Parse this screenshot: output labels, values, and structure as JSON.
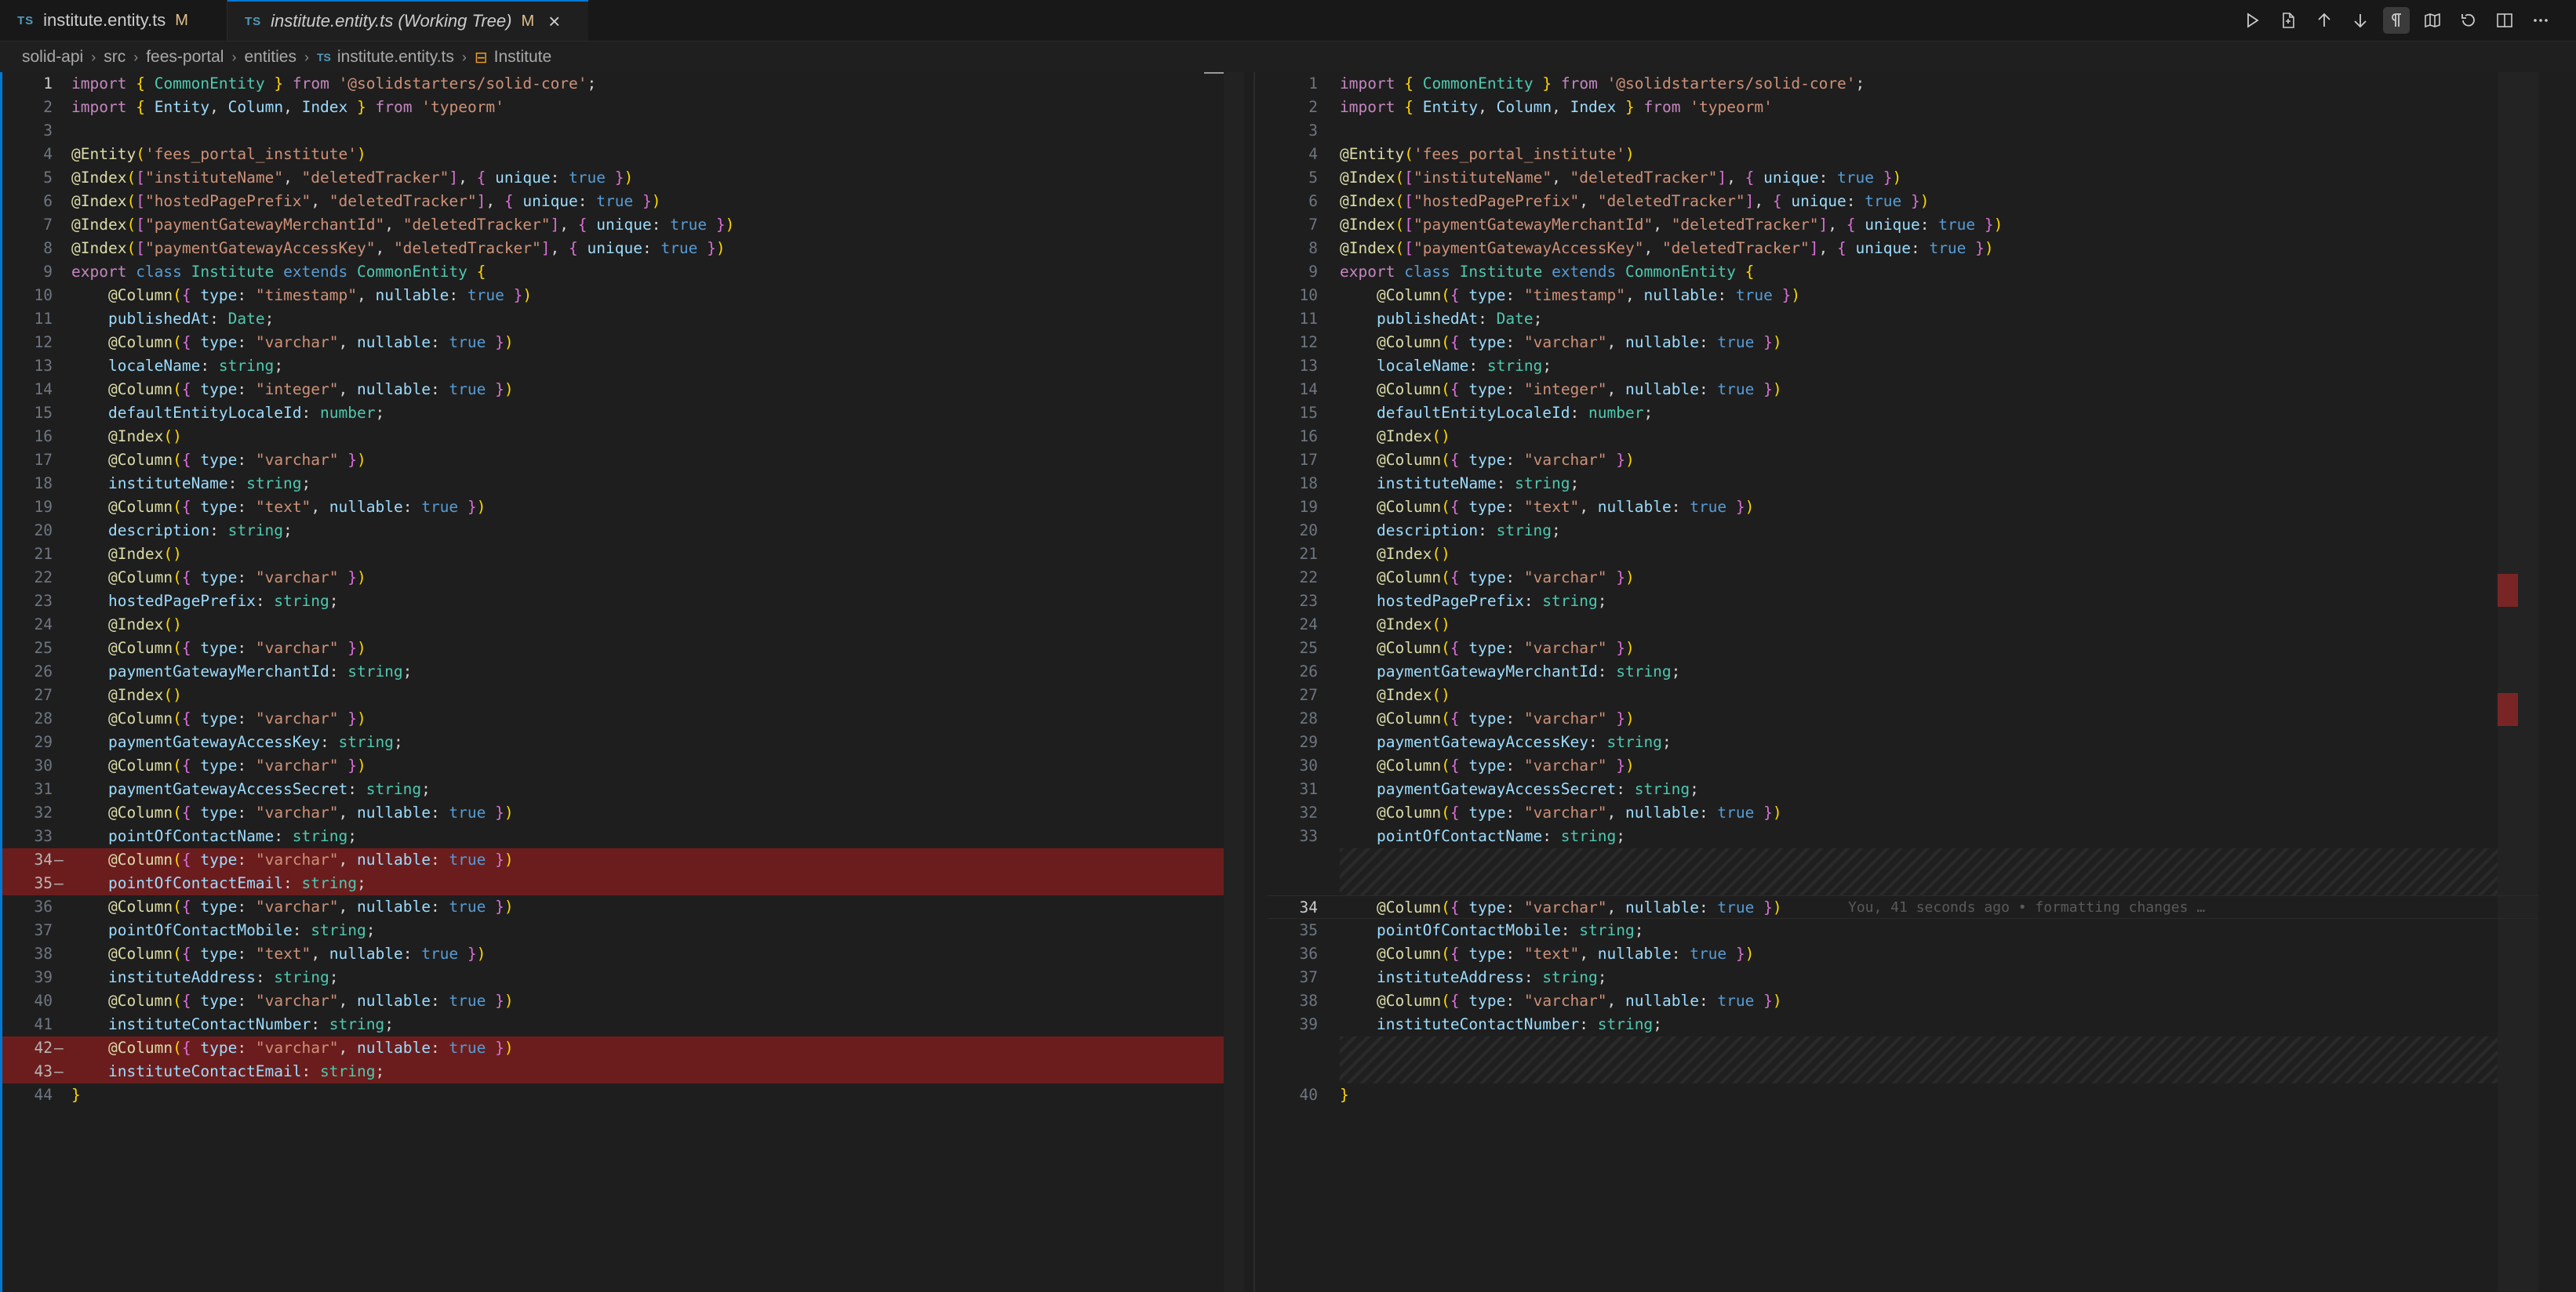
{
  "tabs": [
    {
      "badge": "TS",
      "label": "institute.entity.ts",
      "modified": "M"
    },
    {
      "badge": "TS",
      "label": "institute.entity.ts (Working Tree)",
      "modified": "M",
      "close": "×"
    }
  ],
  "breadcrumb": {
    "items": [
      "solid-api",
      "src",
      "fees-portal",
      "entities"
    ],
    "file_badge": "TS",
    "file": "institute.entity.ts",
    "symbol": "Institute",
    "separator": "›"
  },
  "toolbar_icons": [
    "run-icon",
    "open-file-icon",
    "arrow-up-icon",
    "arrow-down-icon",
    "pilcrow-icon",
    "map-icon",
    "revert-icon",
    "split-editor-icon",
    "more-icon"
  ],
  "left_lines": [
    {
      "n": "1",
      "src": "import { CommonEntity } from '@solidstarters/solid-core';"
    },
    {
      "n": "2",
      "src": "import { Entity, Column, Index } from 'typeorm'"
    },
    {
      "n": "3",
      "src": ""
    },
    {
      "n": "4",
      "src": "@Entity('fees_portal_institute')"
    },
    {
      "n": "5",
      "src": "@Index([\"instituteName\", \"deletedTracker\"], { unique: true })"
    },
    {
      "n": "6",
      "src": "@Index([\"hostedPagePrefix\", \"deletedTracker\"], { unique: true })"
    },
    {
      "n": "7",
      "src": "@Index([\"paymentGatewayMerchantId\", \"deletedTracker\"], { unique: true })"
    },
    {
      "n": "8",
      "src": "@Index([\"paymentGatewayAccessKey\", \"deletedTracker\"], { unique: true })"
    },
    {
      "n": "9",
      "src": "export class Institute extends CommonEntity {"
    },
    {
      "n": "10",
      "src": "    @Column({ type: \"timestamp\", nullable: true })"
    },
    {
      "n": "11",
      "src": "    publishedAt: Date;"
    },
    {
      "n": "12",
      "src": "    @Column({ type: \"varchar\", nullable: true })"
    },
    {
      "n": "13",
      "src": "    localeName: string;"
    },
    {
      "n": "14",
      "src": "    @Column({ type: \"integer\", nullable: true })"
    },
    {
      "n": "15",
      "src": "    defaultEntityLocaleId: number;"
    },
    {
      "n": "16",
      "src": "    @Index()"
    },
    {
      "n": "17",
      "src": "    @Column({ type: \"varchar\" })"
    },
    {
      "n": "18",
      "src": "    instituteName: string;"
    },
    {
      "n": "19",
      "src": "    @Column({ type: \"text\", nullable: true })"
    },
    {
      "n": "20",
      "src": "    description: string;"
    },
    {
      "n": "21",
      "src": "    @Index()"
    },
    {
      "n": "22",
      "src": "    @Column({ type: \"varchar\" })"
    },
    {
      "n": "23",
      "src": "    hostedPagePrefix: string;"
    },
    {
      "n": "24",
      "src": "    @Index()"
    },
    {
      "n": "25",
      "src": "    @Column({ type: \"varchar\" })"
    },
    {
      "n": "26",
      "src": "    paymentGatewayMerchantId: string;"
    },
    {
      "n": "27",
      "src": "    @Index()"
    },
    {
      "n": "28",
      "src": "    @Column({ type: \"varchar\" })"
    },
    {
      "n": "29",
      "src": "    paymentGatewayAccessKey: string;"
    },
    {
      "n": "30",
      "src": "    @Column({ type: \"varchar\" })"
    },
    {
      "n": "31",
      "src": "    paymentGatewayAccessSecret: string;"
    },
    {
      "n": "32",
      "src": "    @Column({ type: \"varchar\", nullable: true })"
    },
    {
      "n": "33",
      "src": "    pointOfContactName: string;"
    },
    {
      "n": "34",
      "src": "    @Column({ type: \"varchar\", nullable: true })",
      "removed": true
    },
    {
      "n": "35",
      "src": "    pointOfContactEmail: string;",
      "removed": true
    },
    {
      "n": "36",
      "src": "    @Column({ type: \"varchar\", nullable: true })"
    },
    {
      "n": "37",
      "src": "    pointOfContactMobile: string;"
    },
    {
      "n": "38",
      "src": "    @Column({ type: \"text\", nullable: true })"
    },
    {
      "n": "39",
      "src": "    instituteAddress: string;"
    },
    {
      "n": "40",
      "src": "    @Column({ type: \"varchar\", nullable: true })"
    },
    {
      "n": "41",
      "src": "    instituteContactNumber: string;"
    },
    {
      "n": "42",
      "src": "    @Column({ type: \"varchar\", nullable: true })",
      "removed": true
    },
    {
      "n": "43",
      "src": "    instituteContactEmail: string;",
      "removed": true
    },
    {
      "n": "44",
      "src": "}"
    }
  ],
  "right_lines": [
    {
      "n": "1",
      "src": "import { CommonEntity } from '@solidstarters/solid-core';"
    },
    {
      "n": "2",
      "src": "import { Entity, Column, Index } from 'typeorm'"
    },
    {
      "n": "3",
      "src": ""
    },
    {
      "n": "4",
      "src": "@Entity('fees_portal_institute')"
    },
    {
      "n": "5",
      "src": "@Index([\"instituteName\", \"deletedTracker\"], { unique: true })"
    },
    {
      "n": "6",
      "src": "@Index([\"hostedPagePrefix\", \"deletedTracker\"], { unique: true })"
    },
    {
      "n": "7",
      "src": "@Index([\"paymentGatewayMerchantId\", \"deletedTracker\"], { unique: true })"
    },
    {
      "n": "8",
      "src": "@Index([\"paymentGatewayAccessKey\", \"deletedTracker\"], { unique: true })"
    },
    {
      "n": "9",
      "src": "export class Institute extends CommonEntity {"
    },
    {
      "n": "10",
      "src": "    @Column({ type: \"timestamp\", nullable: true })"
    },
    {
      "n": "11",
      "src": "    publishedAt: Date;"
    },
    {
      "n": "12",
      "src": "    @Column({ type: \"varchar\", nullable: true })"
    },
    {
      "n": "13",
      "src": "    localeName: string;"
    },
    {
      "n": "14",
      "src": "    @Column({ type: \"integer\", nullable: true })"
    },
    {
      "n": "15",
      "src": "    defaultEntityLocaleId: number;"
    },
    {
      "n": "16",
      "src": "    @Index()"
    },
    {
      "n": "17",
      "src": "    @Column({ type: \"varchar\" })"
    },
    {
      "n": "18",
      "src": "    instituteName: string;"
    },
    {
      "n": "19",
      "src": "    @Column({ type: \"text\", nullable: true })"
    },
    {
      "n": "20",
      "src": "    description: string;"
    },
    {
      "n": "21",
      "src": "    @Index()"
    },
    {
      "n": "22",
      "src": "    @Column({ type: \"varchar\" })"
    },
    {
      "n": "23",
      "src": "    hostedPagePrefix: string;"
    },
    {
      "n": "24",
      "src": "    @Index()"
    },
    {
      "n": "25",
      "src": "    @Column({ type: \"varchar\" })"
    },
    {
      "n": "26",
      "src": "    paymentGatewayMerchantId: string;"
    },
    {
      "n": "27",
      "src": "    @Index()"
    },
    {
      "n": "28",
      "src": "    @Column({ type: \"varchar\" })"
    },
    {
      "n": "29",
      "src": "    paymentGatewayAccessKey: string;"
    },
    {
      "n": "30",
      "src": "    @Column({ type: \"varchar\" })"
    },
    {
      "n": "31",
      "src": "    paymentGatewayAccessSecret: string;"
    },
    {
      "n": "32",
      "src": "    @Column({ type: \"varchar\", nullable: true })"
    },
    {
      "n": "33",
      "src": "    pointOfContactName: string;"
    },
    {
      "n": "34",
      "src": "    @Column({ type: \"varchar\", nullable: true })",
      "current": true,
      "blame": "You, 41 seconds ago • formatting changes …"
    },
    {
      "n": "35",
      "src": "    pointOfContactMobile: string;"
    },
    {
      "n": "36",
      "src": "    @Column({ type: \"text\", nullable: true })"
    },
    {
      "n": "37",
      "src": "    instituteAddress: string;"
    },
    {
      "n": "38",
      "src": "    @Column({ type: \"varchar\", nullable: true })"
    },
    {
      "n": "39",
      "src": "    instituteContactNumber: string;"
    },
    {
      "n": "40",
      "src": "}"
    }
  ],
  "colors": {
    "removed_bg": "#6b1d1d",
    "accent": "#0078d4",
    "modified": "#e2c08d"
  }
}
